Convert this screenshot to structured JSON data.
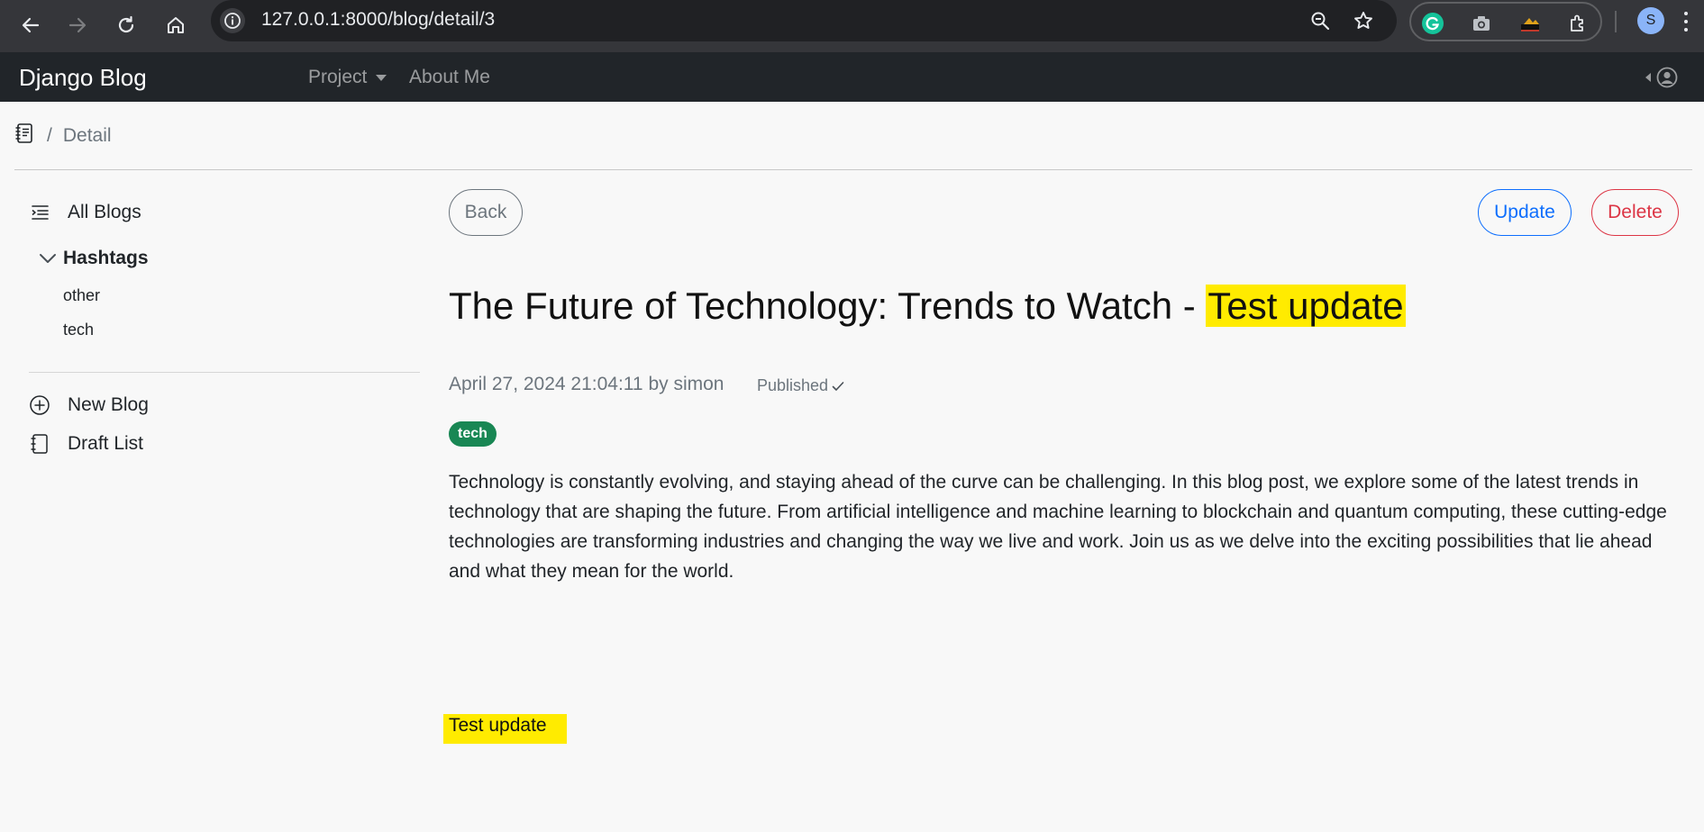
{
  "browser": {
    "url": "127.0.0.1:8000/blog/detail/3",
    "profile_initial": "S"
  },
  "navbar": {
    "brand": "Django Blog",
    "links": [
      "Project",
      "About Me"
    ]
  },
  "breadcrumb": {
    "separator": "/",
    "current": "Detail"
  },
  "sidebar": {
    "all_blogs": "All Blogs",
    "hashtags_label": "Hashtags",
    "hashtags": [
      "other",
      "tech"
    ],
    "new_blog": "New Blog",
    "draft_list": "Draft List"
  },
  "actions": {
    "back": "Back",
    "update": "Update",
    "delete": "Delete"
  },
  "post": {
    "title_main": "The Future of Technology: Trends to Watch - ",
    "title_highlight": "Test update",
    "meta": "April 27, 2024 21:04:11 by simon",
    "status": "Published",
    "tag": "tech",
    "body": "Technology is constantly evolving, and staying ahead of the curve can be challenging. In this blog post, we explore some of the latest trends in technology that are shaping the future. From artificial intelligence and machine learning to blockchain and quantum computing, these cutting-edge technologies are transforming industries and changing the way we live and work. Join us as we delve into the exciting possibilities that lie ahead and what they mean for the world.",
    "footer_note": "Test update"
  },
  "colors": {
    "navbar_bg": "#212529",
    "highlight": "#ffeb00",
    "primary": "#0d6efd",
    "danger": "#dc3545",
    "success": "#198754",
    "secondary": "#6c757d"
  }
}
